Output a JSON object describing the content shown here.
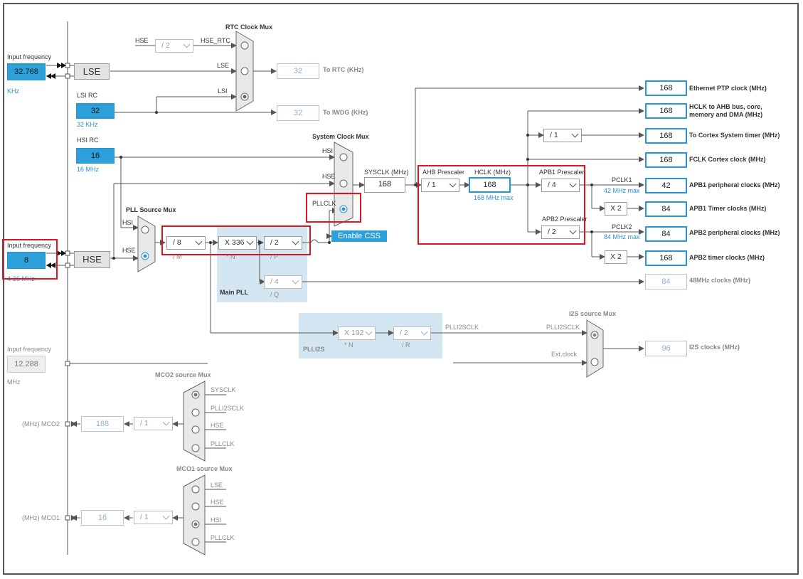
{
  "labels": {
    "input_freq_lse": "Input frequency",
    "lse_value": "32.768",
    "lse_unit": "KHz",
    "lse_box": "LSE",
    "lsi_rc": "LSI RC",
    "lsi_value": "32",
    "lsi_unit": "32 KHz",
    "hsi_rc": "HSI RC",
    "hsi_value": "16",
    "hsi_unit": "16 MHz",
    "input_freq_hse": "Input frequency",
    "hse_value": "8",
    "hse_unit": "4-26 MHz",
    "hse_box": "HSE",
    "input_freq_ext": "Input frequency",
    "ext_value": "12.288",
    "ext_unit": "MHz",
    "rtc_mux": "RTC Clock Mux",
    "rtc_hse": "HSE",
    "rtc_hse_rtc": "HSE_RTC",
    "rtc_lse": "LSE",
    "rtc_lsi": "LSI",
    "rtc_value": "32",
    "to_rtc": "To RTC (KHz)",
    "iwdg_value": "32",
    "to_iwdg": "To IWDG (KHz)",
    "sysclk_mux": "System Clock Mux",
    "sys_hsi": "HSI",
    "sys_hse": "HSE",
    "sys_pllclk": "PLLCLK",
    "sysclk_label": "SYSCLK (MHz)",
    "sysclk_value": "168",
    "pll_src_mux": "PLL Source Mux",
    "pll_hsi": "HSI",
    "pll_hse": "HSE",
    "pllm_label": "/ M",
    "plln_label": "* N",
    "pllp_label": "/ P",
    "pllq_label": "/ Q",
    "main_pll": "Main PLL",
    "enable_css": "Enable CSS",
    "ahb_prescaler": "AHB Prescaler",
    "hclk_label": "HCLK (MHz)",
    "hclk_value": "168",
    "hclk_max": "168 MHz max",
    "apb1_prescaler": "APB1 Prescaler",
    "apb2_prescaler": "APB2 Prescaler",
    "pclk1": "PCLK1",
    "pclk1_max": "42 MHz max",
    "pclk2": "PCLK2",
    "pclk2_max": "84 MHz max",
    "x2_a": "X 2",
    "x2_b": "X 2",
    "plli2s": "PLLI2S",
    "plli2s_n": "* N",
    "plli2s_r": "/ R",
    "plli2sclk": "PLLI2SCLK",
    "i2s_mux": "I2S source Mux",
    "i2s_plli2sclk": "PLLI2SCLK",
    "i2s_ext": "Ext.clock",
    "i2s_value": "96",
    "i2s_out": "I2S clocks (MHz)",
    "mco2_mux": "MCO2 source Mux",
    "mco2_sysclk": "SYSCLK",
    "mco2_plli2sclk": "PLLI2SCLK",
    "mco2_hse": "HSE",
    "mco2_pllclk": "PLLCLK",
    "mco2_label": "(MHz) MCO2",
    "mco2_value": "168",
    "mco1_mux": "MCO1 source Mux",
    "mco1_lse": "LSE",
    "mco1_hse": "HSE",
    "mco1_hsi": "HSI",
    "mco1_pllclk": "PLLCLK",
    "mco1_label": "(MHz) MCO1",
    "mco1_value": "16"
  },
  "selects": {
    "rtc_div": "/ 2",
    "pll_m": "/ 8",
    "pll_n": "X 336",
    "pll_p": "/ 2",
    "pll_q": "/ 4",
    "ahb": "/ 1",
    "cortex_div": "/ 1",
    "apb1": "/ 4",
    "apb2": "/ 2",
    "plli2s_n": "X 192",
    "plli2s_r": "/ 2",
    "mco2_div": "/ 1",
    "mco1_div": "/ 1"
  },
  "outputs": [
    {
      "value": "168",
      "label": "Ethernet PTP clock (MHz)"
    },
    {
      "value": "168",
      "label": "HCLK to AHB bus, core, memory and DMA (MHz)"
    },
    {
      "value": "168",
      "label": "To Cortex System timer (MHz)"
    },
    {
      "value": "168",
      "label": "FCLK Cortex clock (MHz)"
    },
    {
      "value": "42",
      "label": "APB1 peripheral clocks (MHz)"
    },
    {
      "value": "84",
      "label": "APB1 Timer clocks (MHz)"
    },
    {
      "value": "84",
      "label": "APB2 peripheral clocks (MHz)"
    },
    {
      "value": "168",
      "label": "APB2 timer clocks (MHz)"
    },
    {
      "value": "84",
      "label": "48MHz clocks (MHz)"
    }
  ],
  "colors": {
    "accent": "#2d9fd9",
    "highlight": "#e0141e",
    "pll_background": "#d5e6f3",
    "wire": "#555555"
  }
}
